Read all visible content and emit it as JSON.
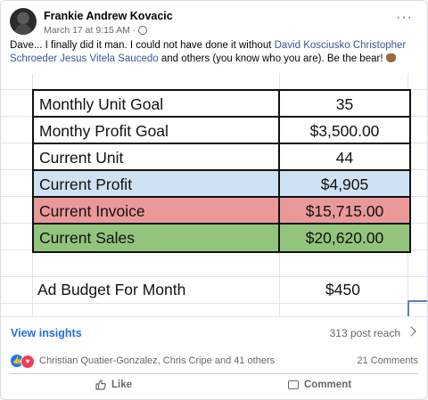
{
  "post": {
    "author": "Frankie Andrew Kovacic",
    "timestamp": "March 17 at 9:15 AM",
    "separator": "·",
    "more_label": "···",
    "text_prefix": "Dave... I finally did it man. I could not have done it without ",
    "mention": "David Kosciusko Christopher Schroeder Jesus Vitela Saucedo",
    "text_suffix": " and others (you know who you are). Be the bear! ",
    "emoji": "bear-face-emoji"
  },
  "sheet": {
    "rows": [
      {
        "label": "Monthly Unit Goal",
        "value": "35",
        "color": "#ffffff"
      },
      {
        "label": "Monthy Profit Goal",
        "value": "$3,500.00",
        "color": "#ffffff"
      },
      {
        "label": "Current Unit",
        "value": "44",
        "color": "#ffffff"
      },
      {
        "label": "Current Profit",
        "value": "$4,905",
        "color": "#cfe2f3"
      },
      {
        "label": "Current Invoice",
        "value": "$15,715.00",
        "color": "#ea9999"
      },
      {
        "label": "Current Sales",
        "value": "$20,620.00",
        "color": "#93c47d"
      }
    ],
    "budget_label": "Ad Budget For Month",
    "budget_value": "$450"
  },
  "insights": {
    "link": "View insights",
    "reach": "313 post reach"
  },
  "reactions": {
    "names": "Christian Quatier-Gonzalez, Chris Cripe and 41 others",
    "comments": "21 Comments",
    "icons": [
      "like-reaction-icon",
      "love-reaction-icon"
    ]
  },
  "actions": {
    "like": "Like",
    "comment": "Comment"
  }
}
